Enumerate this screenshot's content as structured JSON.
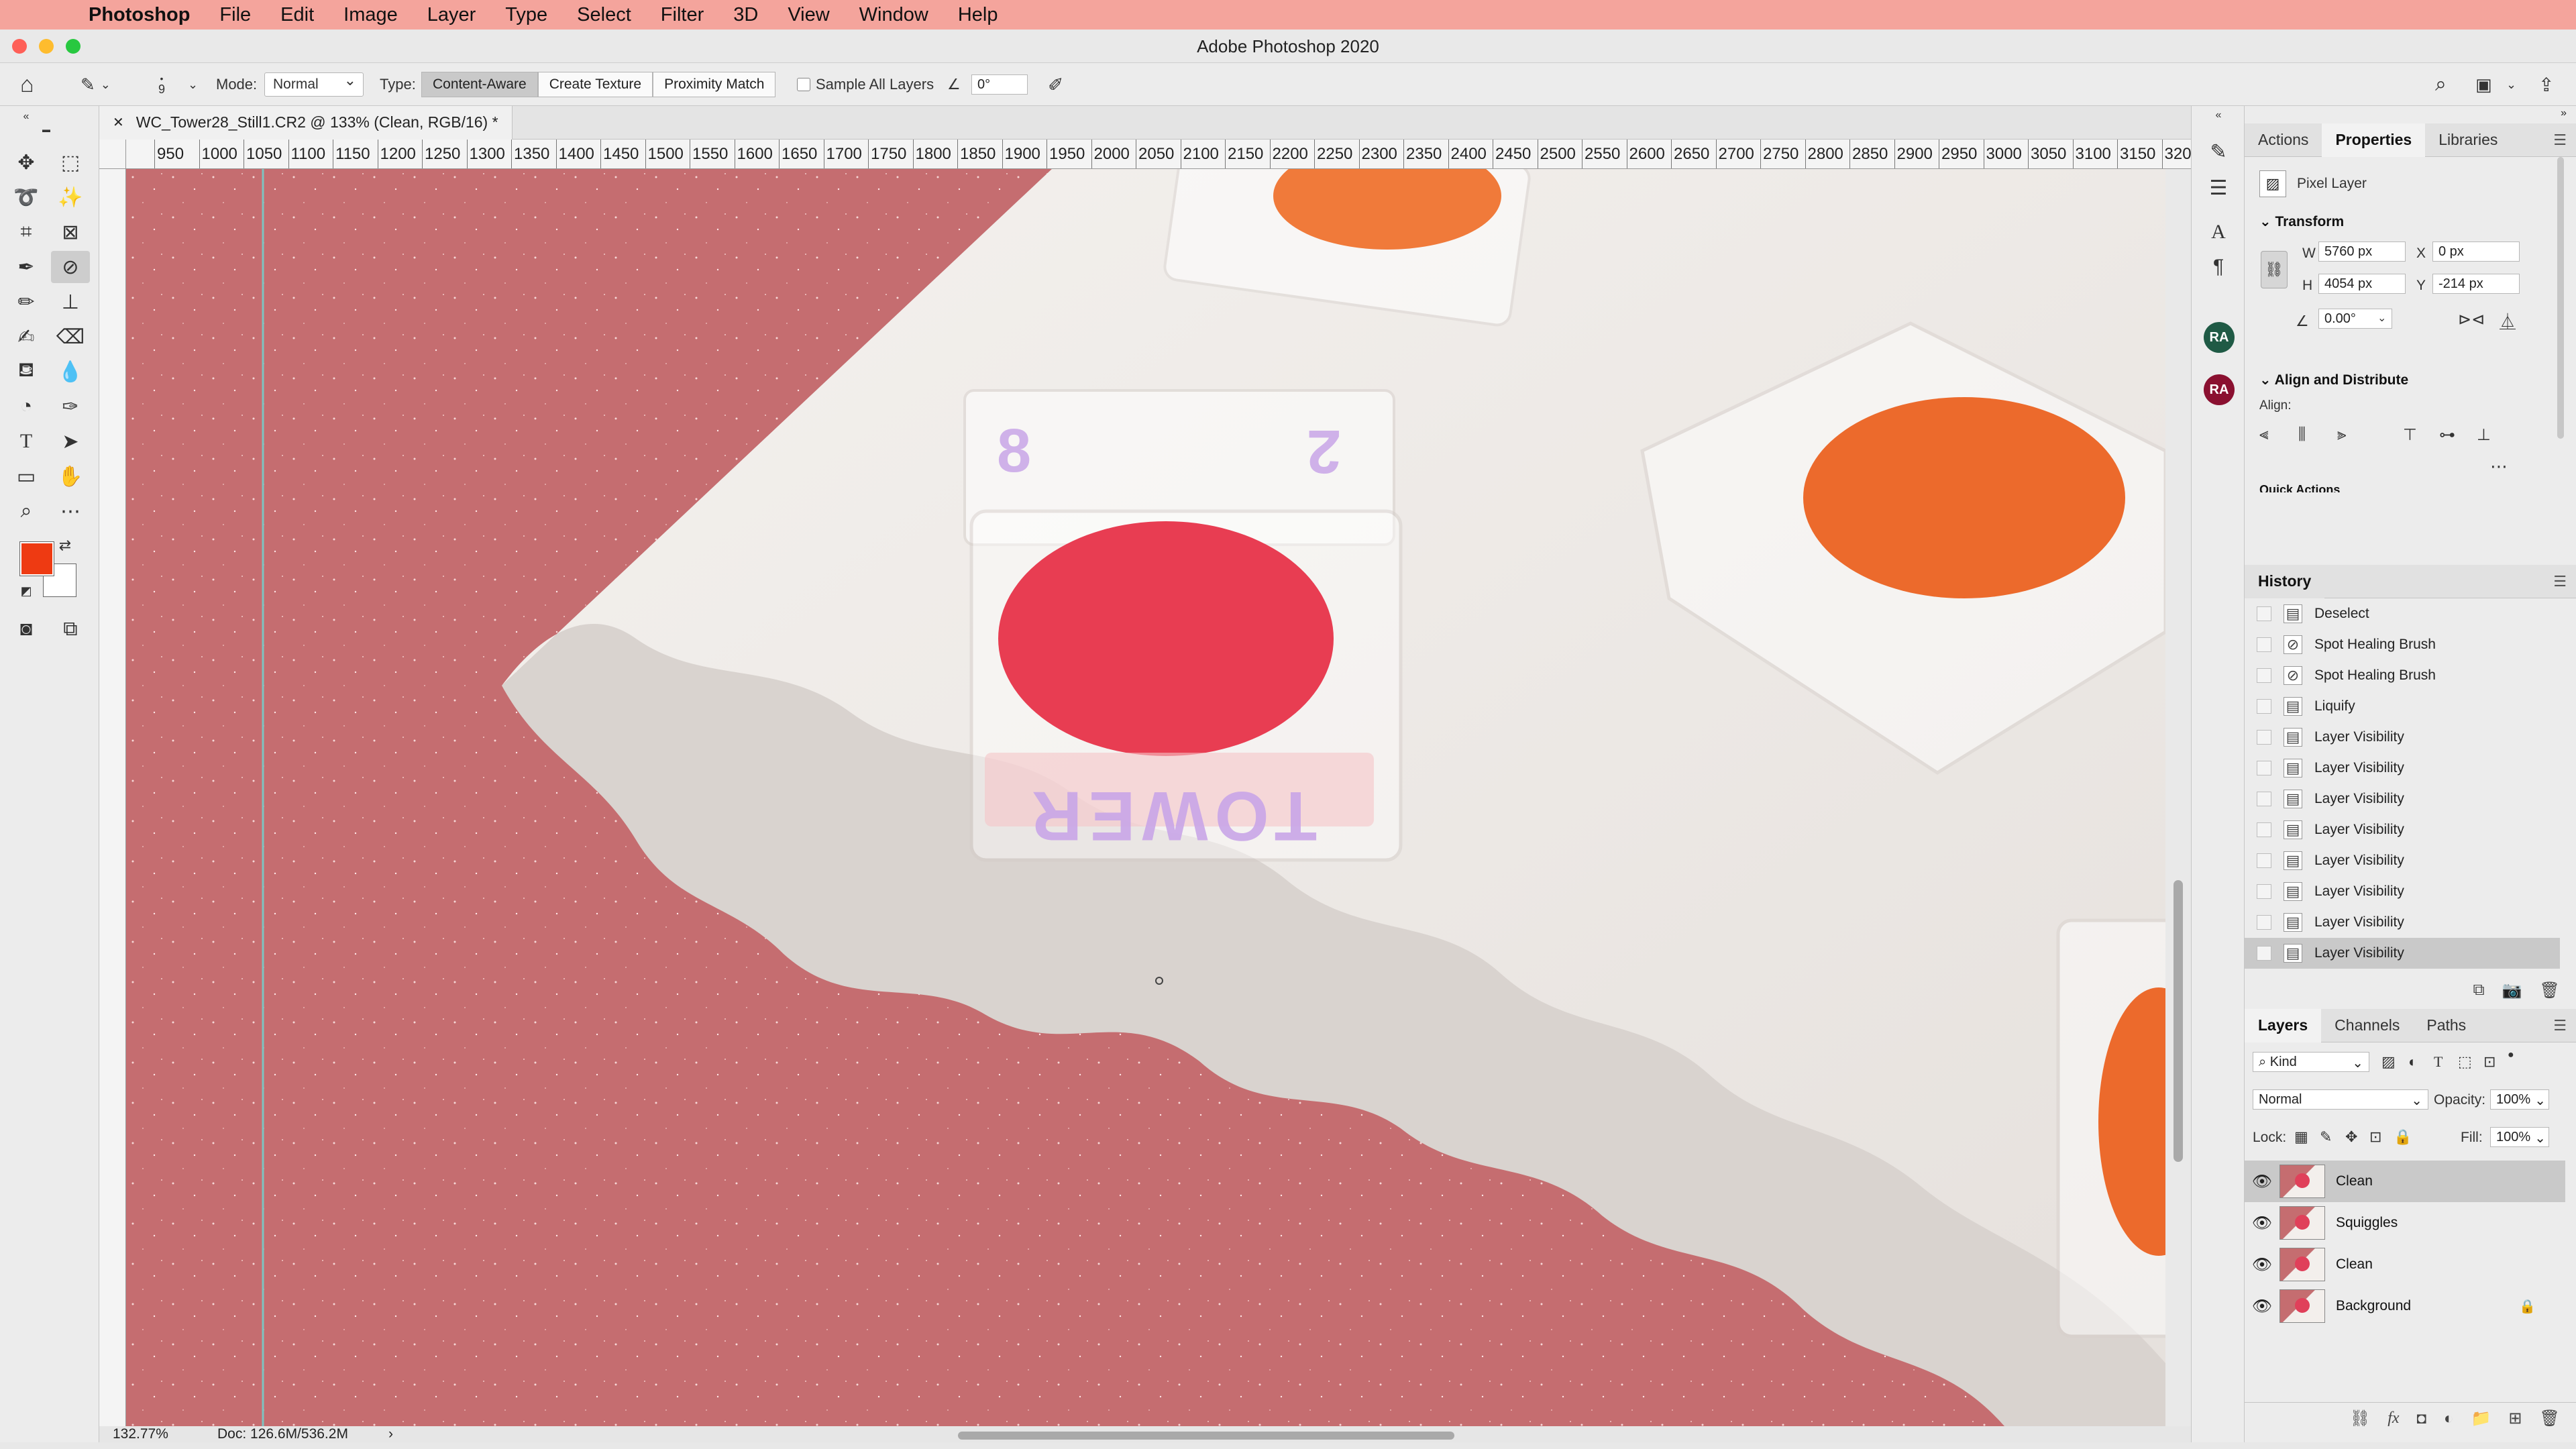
{
  "menubar": {
    "apple": "",
    "app": "Photoshop",
    "items": [
      "File",
      "Edit",
      "Image",
      "Layer",
      "Type",
      "Select",
      "Filter",
      "3D",
      "View",
      "Window",
      "Help"
    ]
  },
  "window": {
    "title": "Adobe Photoshop 2020"
  },
  "options": {
    "brush_size": "9",
    "mode_label": "Mode:",
    "mode_value": "Normal",
    "type_label": "Type:",
    "type_buttons": [
      "Content-Aware",
      "Create Texture",
      "Proximity Match"
    ],
    "type_active": "Content-Aware",
    "sample_all_layers": "Sample All Layers",
    "angle_value": "0°"
  },
  "document": {
    "tab_title": "WC_Tower28_Still1.CR2 @ 133% (Clean, RGB/16) *",
    "zoom": "132.77%",
    "doc_size": "Doc: 126.6M/536.2M",
    "ruler_h": [
      "950",
      "1000",
      "1050",
      "1100",
      "1150",
      "1200",
      "1250",
      "1300",
      "1350",
      "1400",
      "1450",
      "1500",
      "1550",
      "1600",
      "1650",
      "1700",
      "1750",
      "1800",
      "1850",
      "1900",
      "1950",
      "2000",
      "2050",
      "2100",
      "2150",
      "2200",
      "2250",
      "2300",
      "2350",
      "2400",
      "2450",
      "2500",
      "2550",
      "2600",
      "2650",
      "2700",
      "2750",
      "2800",
      "2850",
      "2900",
      "2950",
      "3000",
      "3050",
      "3100",
      "3150",
      "320"
    ],
    "compact_label_left": "8",
    "compact_label_right": "2",
    "compact_brand": "TOWER"
  },
  "strip": {
    "avatar1": "RA",
    "avatar2": "RA"
  },
  "colors": {
    "foreground": "#ee3a12",
    "background": "#ffffff",
    "avatar1": "#1f5a45",
    "avatar2": "#8a1030"
  },
  "properties": {
    "tabs": [
      "Actions",
      "Properties",
      "Libraries"
    ],
    "active_tab": "Properties",
    "layer_type": "Pixel Layer",
    "transform_title": "Transform",
    "w_label": "W",
    "w_value": "5760 px",
    "h_label": "H",
    "h_value": "4054 px",
    "x_label": "X",
    "x_value": "0 px",
    "y_label": "Y",
    "y_value": "-214 px",
    "angle_value": "0.00°",
    "align_title": "Align and Distribute",
    "align_label": "Align:",
    "quick_actions": "Quick Actions"
  },
  "history": {
    "title": "History",
    "items": [
      "Deselect",
      "Spot Healing Brush",
      "Spot Healing Brush",
      "Liquify",
      "Layer Visibility",
      "Layer Visibility",
      "Layer Visibility",
      "Layer Visibility",
      "Layer Visibility",
      "Layer Visibility",
      "Layer Visibility",
      "Layer Visibility"
    ],
    "selected_index": 11
  },
  "layers": {
    "tabs": [
      "Layers",
      "Channels",
      "Paths"
    ],
    "active_tab": "Layers",
    "filter": "Kind",
    "blend_mode": "Normal",
    "opacity_label": "Opacity:",
    "opacity_value": "100%",
    "lock_label": "Lock:",
    "fill_label": "Fill:",
    "fill_value": "100%",
    "items": [
      {
        "name": "Clean",
        "visible": true,
        "selected": true,
        "locked": false
      },
      {
        "name": "Squiggles",
        "visible": true,
        "selected": false,
        "locked": false
      },
      {
        "name": "Clean",
        "visible": true,
        "selected": false,
        "locked": false
      },
      {
        "name": "Background",
        "visible": true,
        "selected": false,
        "locked": true
      }
    ]
  }
}
